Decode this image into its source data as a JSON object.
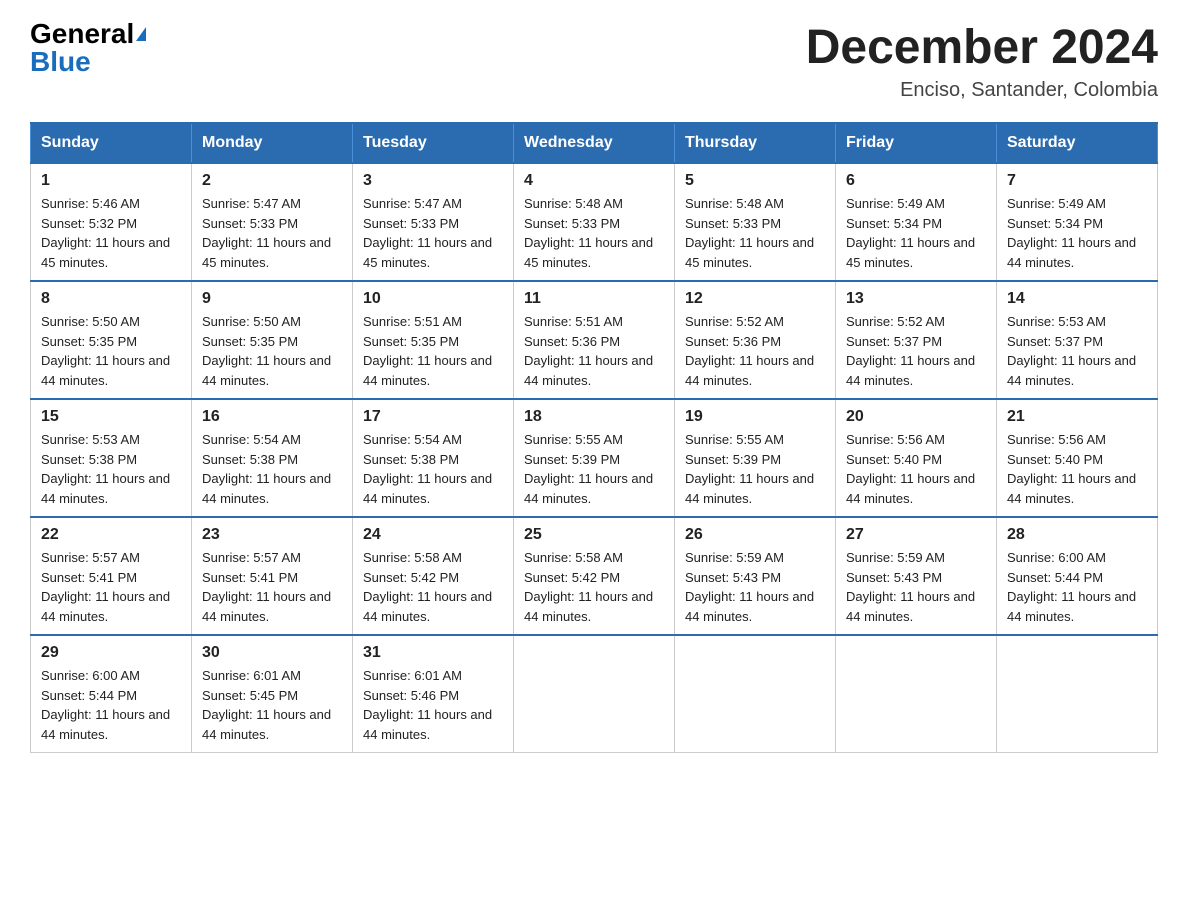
{
  "logo": {
    "general": "General",
    "blue": "Blue"
  },
  "title": "December 2024",
  "location": "Enciso, Santander, Colombia",
  "headers": [
    "Sunday",
    "Monday",
    "Tuesday",
    "Wednesday",
    "Thursday",
    "Friday",
    "Saturday"
  ],
  "weeks": [
    [
      {
        "day": "1",
        "sunrise": "5:46 AM",
        "sunset": "5:32 PM",
        "daylight": "11 hours and 45 minutes."
      },
      {
        "day": "2",
        "sunrise": "5:47 AM",
        "sunset": "5:33 PM",
        "daylight": "11 hours and 45 minutes."
      },
      {
        "day": "3",
        "sunrise": "5:47 AM",
        "sunset": "5:33 PM",
        "daylight": "11 hours and 45 minutes."
      },
      {
        "day": "4",
        "sunrise": "5:48 AM",
        "sunset": "5:33 PM",
        "daylight": "11 hours and 45 minutes."
      },
      {
        "day": "5",
        "sunrise": "5:48 AM",
        "sunset": "5:33 PM",
        "daylight": "11 hours and 45 minutes."
      },
      {
        "day": "6",
        "sunrise": "5:49 AM",
        "sunset": "5:34 PM",
        "daylight": "11 hours and 45 minutes."
      },
      {
        "day": "7",
        "sunrise": "5:49 AM",
        "sunset": "5:34 PM",
        "daylight": "11 hours and 44 minutes."
      }
    ],
    [
      {
        "day": "8",
        "sunrise": "5:50 AM",
        "sunset": "5:35 PM",
        "daylight": "11 hours and 44 minutes."
      },
      {
        "day": "9",
        "sunrise": "5:50 AM",
        "sunset": "5:35 PM",
        "daylight": "11 hours and 44 minutes."
      },
      {
        "day": "10",
        "sunrise": "5:51 AM",
        "sunset": "5:35 PM",
        "daylight": "11 hours and 44 minutes."
      },
      {
        "day": "11",
        "sunrise": "5:51 AM",
        "sunset": "5:36 PM",
        "daylight": "11 hours and 44 minutes."
      },
      {
        "day": "12",
        "sunrise": "5:52 AM",
        "sunset": "5:36 PM",
        "daylight": "11 hours and 44 minutes."
      },
      {
        "day": "13",
        "sunrise": "5:52 AM",
        "sunset": "5:37 PM",
        "daylight": "11 hours and 44 minutes."
      },
      {
        "day": "14",
        "sunrise": "5:53 AM",
        "sunset": "5:37 PM",
        "daylight": "11 hours and 44 minutes."
      }
    ],
    [
      {
        "day": "15",
        "sunrise": "5:53 AM",
        "sunset": "5:38 PM",
        "daylight": "11 hours and 44 minutes."
      },
      {
        "day": "16",
        "sunrise": "5:54 AM",
        "sunset": "5:38 PM",
        "daylight": "11 hours and 44 minutes."
      },
      {
        "day": "17",
        "sunrise": "5:54 AM",
        "sunset": "5:38 PM",
        "daylight": "11 hours and 44 minutes."
      },
      {
        "day": "18",
        "sunrise": "5:55 AM",
        "sunset": "5:39 PM",
        "daylight": "11 hours and 44 minutes."
      },
      {
        "day": "19",
        "sunrise": "5:55 AM",
        "sunset": "5:39 PM",
        "daylight": "11 hours and 44 minutes."
      },
      {
        "day": "20",
        "sunrise": "5:56 AM",
        "sunset": "5:40 PM",
        "daylight": "11 hours and 44 minutes."
      },
      {
        "day": "21",
        "sunrise": "5:56 AM",
        "sunset": "5:40 PM",
        "daylight": "11 hours and 44 minutes."
      }
    ],
    [
      {
        "day": "22",
        "sunrise": "5:57 AM",
        "sunset": "5:41 PM",
        "daylight": "11 hours and 44 minutes."
      },
      {
        "day": "23",
        "sunrise": "5:57 AM",
        "sunset": "5:41 PM",
        "daylight": "11 hours and 44 minutes."
      },
      {
        "day": "24",
        "sunrise": "5:58 AM",
        "sunset": "5:42 PM",
        "daylight": "11 hours and 44 minutes."
      },
      {
        "day": "25",
        "sunrise": "5:58 AM",
        "sunset": "5:42 PM",
        "daylight": "11 hours and 44 minutes."
      },
      {
        "day": "26",
        "sunrise": "5:59 AM",
        "sunset": "5:43 PM",
        "daylight": "11 hours and 44 minutes."
      },
      {
        "day": "27",
        "sunrise": "5:59 AM",
        "sunset": "5:43 PM",
        "daylight": "11 hours and 44 minutes."
      },
      {
        "day": "28",
        "sunrise": "6:00 AM",
        "sunset": "5:44 PM",
        "daylight": "11 hours and 44 minutes."
      }
    ],
    [
      {
        "day": "29",
        "sunrise": "6:00 AM",
        "sunset": "5:44 PM",
        "daylight": "11 hours and 44 minutes."
      },
      {
        "day": "30",
        "sunrise": "6:01 AM",
        "sunset": "5:45 PM",
        "daylight": "11 hours and 44 minutes."
      },
      {
        "day": "31",
        "sunrise": "6:01 AM",
        "sunset": "5:46 PM",
        "daylight": "11 hours and 44 minutes."
      },
      null,
      null,
      null,
      null
    ]
  ]
}
